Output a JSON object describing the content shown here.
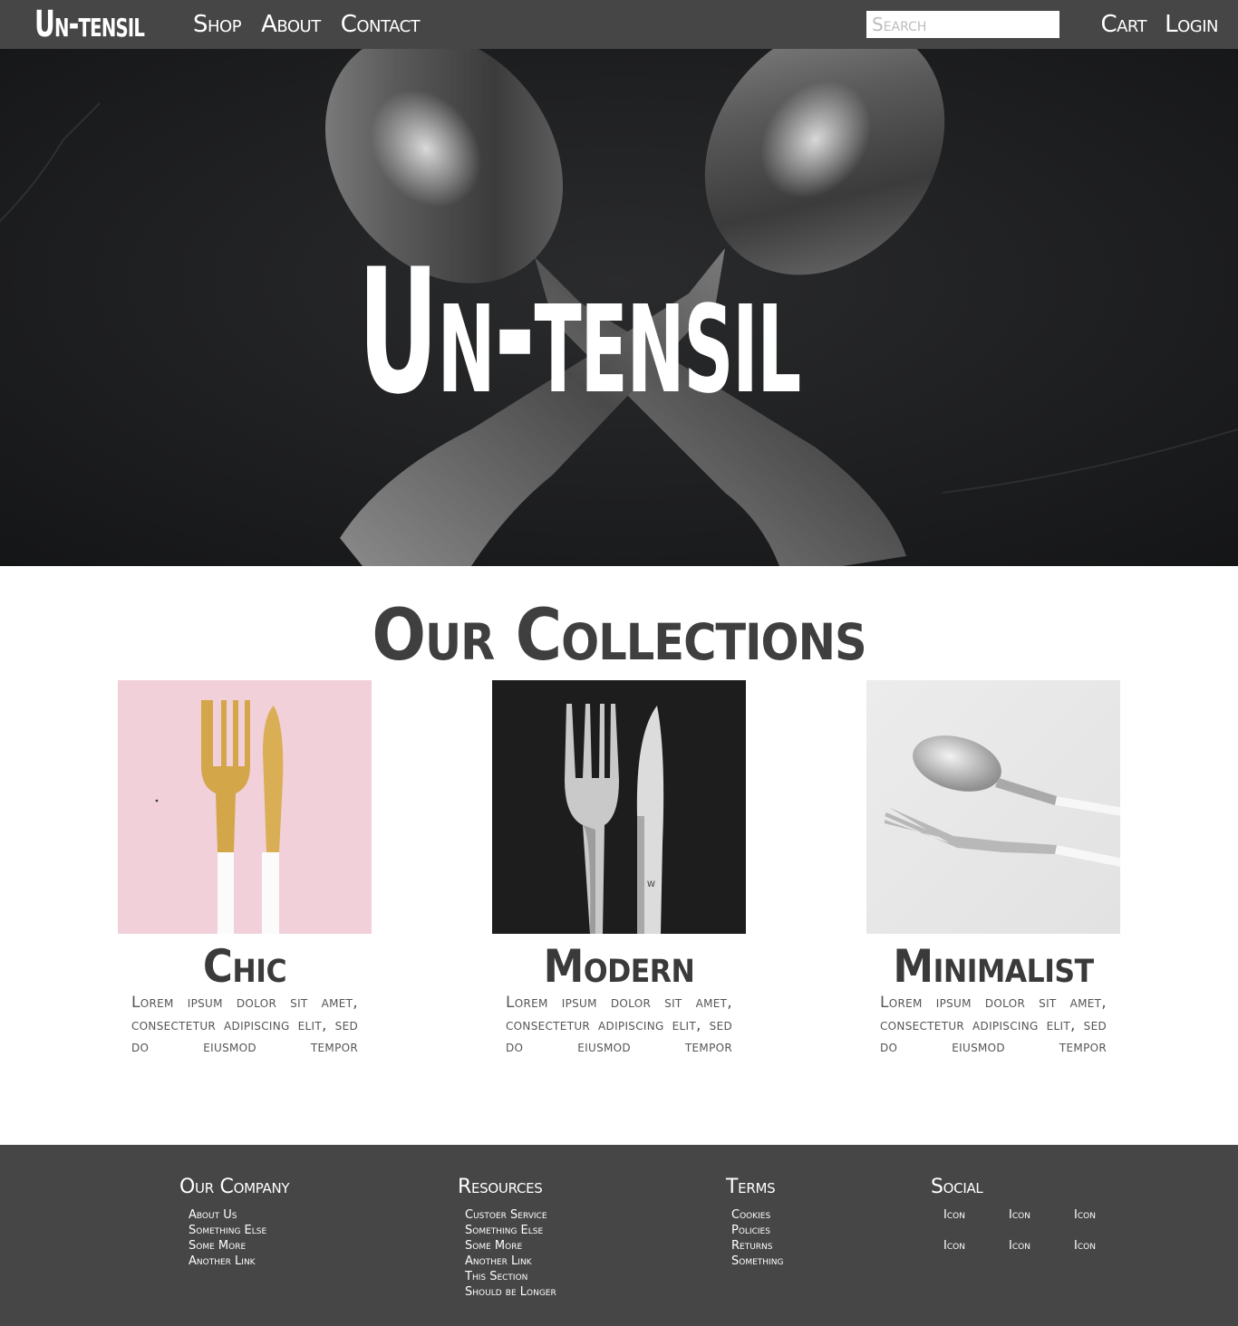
{
  "nav": {
    "brand": "Un-tensil",
    "links": [
      "Shop",
      "About",
      "Contact"
    ],
    "search_placeholder": "Search",
    "cart": "Cart",
    "login": "Login"
  },
  "hero": {
    "title": "Un-tensil",
    "background_color": "#1c1d1f"
  },
  "collections": {
    "title": "Our Collections",
    "items": [
      {
        "title": "Chic",
        "body": "Lorem ipsum dolor sit amet, consectetur adipiscing elit, sed do eiusmod tempor"
      },
      {
        "title": "Modern",
        "body": "Lorem ipsum dolor sit amet, consectetur adipiscing elit, sed do eiusmod tempor"
      },
      {
        "title": "Minimalist",
        "body": "Lorem ipsum dolor sit amet, consectetur adipiscing elit, sed do eiusmod tempor"
      }
    ]
  },
  "footer": {
    "company": {
      "title": "Our Company",
      "links": [
        "About Us",
        "Something Else",
        "Some More",
        "Another Link"
      ]
    },
    "resources": {
      "title": "Resources",
      "links": [
        "Custoer Service",
        "Something Else",
        "Some More",
        "Another Link",
        "This Section",
        "Should be Longer"
      ]
    },
    "terms": {
      "title": "Terms",
      "links": [
        "Cookies",
        "Policies",
        "Returns",
        "Something"
      ]
    },
    "social": {
      "title": "Social",
      "icons": [
        "Icon",
        "Icon",
        "Icon",
        "Icon",
        "Icon",
        "Icon"
      ]
    }
  },
  "colors": {
    "nav_bg": "#464646",
    "footer_bg": "#464646",
    "heading_text": "#3f3f3f"
  }
}
